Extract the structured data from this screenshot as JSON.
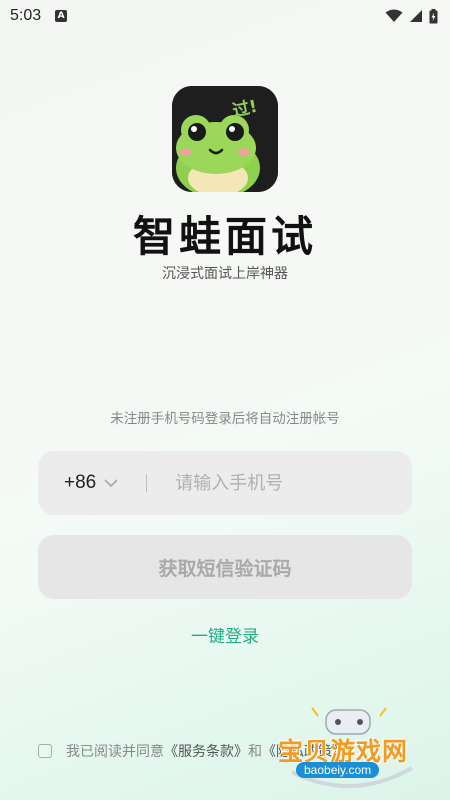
{
  "status_bar": {
    "time": "5:03",
    "notification_icon": "a-letter-icon",
    "wifi_icon": "wifi-icon",
    "signal_icon": "cell-signal-icon",
    "battery_icon": "battery-charging-icon"
  },
  "app": {
    "logo_badge": "过!",
    "name": "智蛙面试",
    "slogan": "沉浸式面试上岸神器"
  },
  "login": {
    "hint": "未注册手机号码登录后将自动注册帐号",
    "country_code": "+86",
    "phone_placeholder": "请输入手机号",
    "phone_value": "",
    "sms_button": "获取短信验证码",
    "one_click_login": "一键登录"
  },
  "agreement": {
    "prefix": "我已阅读并同意",
    "terms": "《服务条款》",
    "and": "和",
    "privacy": "《隐私政策》",
    "checked": false
  },
  "watermark": {
    "text": "宝贝游戏网",
    "url": "baobeiy.com"
  },
  "colors": {
    "accent": "#1fae88",
    "button_bg": "#e6e6e6",
    "watermark_orange": "#f39a1f",
    "watermark_blue": "#1a8fd6"
  }
}
